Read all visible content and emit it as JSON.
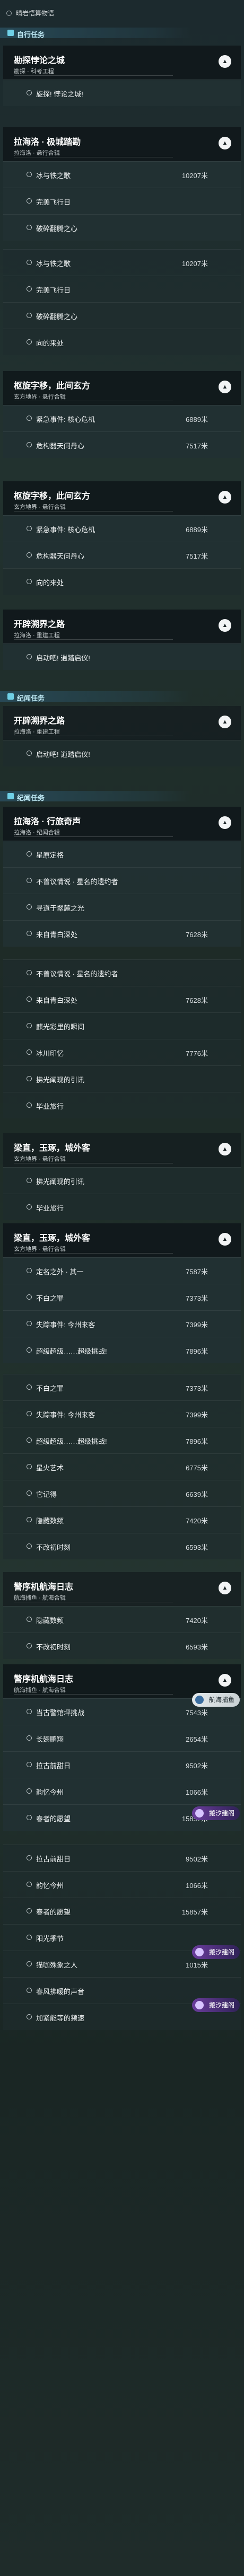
{
  "ghost_top": "· 晴岩悟算物语",
  "section_ongoing": "自行任务",
  "section_world": "纪闻任务",
  "groups": [
    {
      "title": "勘探悖论之城",
      "sub": "勘探 · 科考工程"
    },
    {
      "title": "拉海洛 · 极城踏勘",
      "sub": "拉海洛 · 悬行合辑"
    },
    {
      "title": "拉海洛 · 行旅奇声",
      "sub": "拉海洛 · 纪闻合辑"
    },
    {
      "title": "枢旋字移，此间玄方",
      "sub": "玄方地界 · 悬行合辑"
    },
    {
      "title": "开辟溯界之路",
      "sub": "拉海洛 · 重建工程"
    },
    {
      "title": "梁直，玉琢，城外客",
      "sub": "玄方地界 · 悬行合辑"
    },
    {
      "title": "警序机航海日志",
      "sub": "航海捕鱼 · 航海合辑"
    }
  ],
  "tasks": [
    {
      "label": "旋探! 悖论之城!",
      "dist": ""
    },
    {
      "label": "冰与铁之歌",
      "dist": "10207米"
    },
    {
      "label": "完美飞行日",
      "dist": ""
    },
    {
      "label": "破碎翻腾之心",
      "dist": ""
    },
    {
      "label": "向的来处",
      "dist": ""
    },
    {
      "label": "紧急事件: 核心危机",
      "dist": "6889米"
    },
    {
      "label": "危构器天问丹心",
      "dist": "7517米"
    },
    {
      "label": "启动吧! 逍踏启仪!",
      "dist": ""
    },
    {
      "label": "星原定格",
      "dist": ""
    },
    {
      "label": "不曾议情说 · 星名的遗约者",
      "dist": ""
    },
    {
      "label": "寻道于翠麓之光",
      "dist": ""
    },
    {
      "label": "来自青白深处",
      "dist": "7628米"
    },
    {
      "label": "麒光彩里的瞬间",
      "dist": ""
    },
    {
      "label": "冰川印忆",
      "dist": "7776米"
    },
    {
      "label": "拂光阐现的引讯",
      "dist": ""
    },
    {
      "label": "毕业旅行",
      "dist": ""
    },
    {
      "label": "定名之外 · 其一",
      "dist": "7587米"
    },
    {
      "label": "不白之罪",
      "dist": "7373米"
    },
    {
      "label": "失踪事件: 今州来客",
      "dist": "7399米"
    },
    {
      "label": "超级超级……超级挑战!",
      "dist": "7896米"
    },
    {
      "label": "星火艺术",
      "dist": "6775米"
    },
    {
      "label": "它记得",
      "dist": "6639米"
    },
    {
      "label": "隐藏数频",
      "dist": "7420米"
    },
    {
      "label": "不改初时刻",
      "dist": "6593米"
    },
    {
      "label": "当古警馆坪挑战",
      "dist": "7543米"
    },
    {
      "label": "长翅鹏翔",
      "dist": "2654米"
    },
    {
      "label": "拉古前甜日",
      "dist": "9502米"
    },
    {
      "label": "韵忆今州",
      "dist": "1066米"
    },
    {
      "label": "春者的愿望",
      "dist": "15857米"
    },
    {
      "label": "阳光季节",
      "dist": ""
    },
    {
      "label": "猫咖殊象之人",
      "dist": "1015米"
    },
    {
      "label": "春风拂暖的声音",
      "dist": ""
    },
    {
      "label": "加紧能等的频速",
      "dist": ""
    }
  ],
  "badges": {
    "nav": "航海捕鱼",
    "help": "搬汐建阁"
  }
}
